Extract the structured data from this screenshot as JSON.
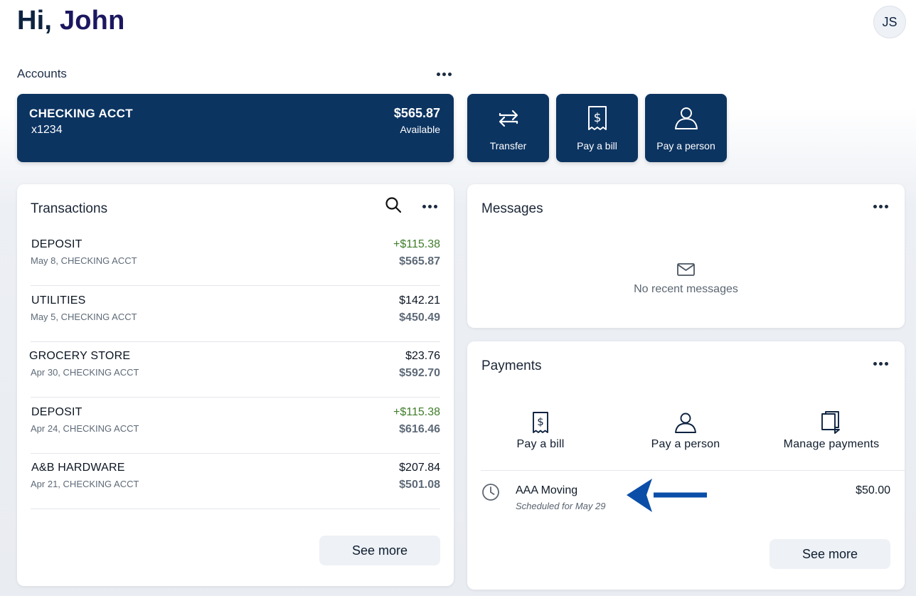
{
  "header": {
    "greeting_prefix": "Hi,",
    "user_name": "John",
    "avatar_initials": "JS"
  },
  "accounts": {
    "section_label": "Accounts",
    "card": {
      "name": "CHECKING ACCT",
      "number": "x1234",
      "balance": "$565.87",
      "balance_label": "Available"
    },
    "quick_actions": [
      {
        "label": "Transfer",
        "icon": "transfer-arrows-icon"
      },
      {
        "label": "Pay a bill",
        "icon": "bill-receipt-icon"
      },
      {
        "label": "Pay a person",
        "icon": "person-icon"
      }
    ]
  },
  "transactions": {
    "title": "Transactions",
    "rows": [
      {
        "name": "DEPOSIT",
        "date": "May 8,",
        "account": "CHECKING ACCT",
        "amount": "+$115.38",
        "positive": true,
        "balance": "$565.87"
      },
      {
        "name": "UTILITIES",
        "date": "May 5,",
        "account": "CHECKING ACCT",
        "amount": "$142.21",
        "positive": false,
        "balance": "$450.49"
      },
      {
        "name": "GROCERY STORE",
        "date": "Apr 30,",
        "account": "CHECKING ACCT",
        "amount": "$23.76",
        "positive": false,
        "balance": "$592.70"
      },
      {
        "name": "DEPOSIT",
        "date": "Apr 24,",
        "account": "CHECKING ACCT",
        "amount": "+$115.38",
        "positive": true,
        "balance": "$616.46"
      },
      {
        "name": "A&B HARDWARE",
        "date": "Apr 21,",
        "account": "CHECKING ACCT",
        "amount": "$207.84",
        "positive": false,
        "balance": "$501.08"
      }
    ],
    "see_more_label": "See more"
  },
  "messages": {
    "title": "Messages",
    "empty_text": "No recent messages"
  },
  "payments": {
    "title": "Payments",
    "actions": [
      {
        "label": "Pay a bill",
        "icon": "bill-receipt-icon"
      },
      {
        "label": "Pay a person",
        "icon": "person-icon"
      },
      {
        "label": "Manage payments",
        "icon": "documents-icon"
      }
    ],
    "scheduled": {
      "payee": "AAA Moving",
      "status": "Scheduled for May 29",
      "amount": "$50.00"
    },
    "see_more_label": "See more"
  },
  "colors": {
    "navy": "#0c3461",
    "positive_green": "#3f7d2a",
    "annotation_arrow": "#0a4ea8"
  }
}
